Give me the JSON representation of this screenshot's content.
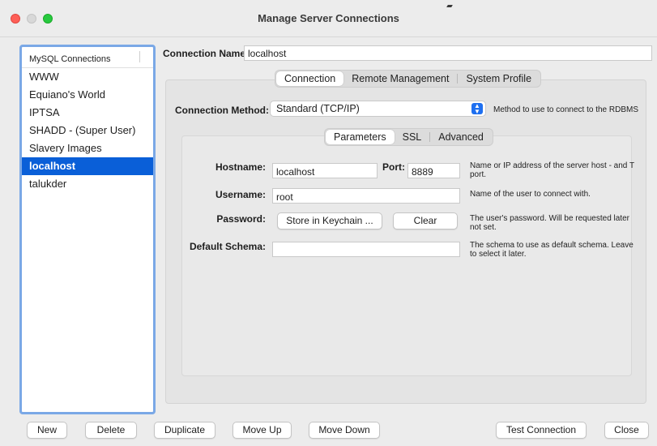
{
  "window": {
    "title": "Manage Server Connections"
  },
  "sidebar": {
    "header": "MySQL Connections",
    "items": [
      {
        "label": "WWW",
        "selected": false
      },
      {
        "label": "Equiano's World",
        "selected": false
      },
      {
        "label": "IPTSA",
        "selected": false
      },
      {
        "label": "SHADD - (Super User)",
        "selected": false
      },
      {
        "label": "Slavery Images",
        "selected": false
      },
      {
        "label": "localhost",
        "selected": true
      },
      {
        "label": "talukder",
        "selected": false
      }
    ]
  },
  "connection_name": {
    "label": "Connection Name:",
    "value": "localhost"
  },
  "main_tabs": [
    {
      "label": "Connection",
      "active": true
    },
    {
      "label": "Remote Management",
      "active": false
    },
    {
      "label": "System Profile",
      "active": false
    }
  ],
  "connection_method": {
    "label": "Connection Method:",
    "value": "Standard (TCP/IP)",
    "help": "Method to use to connect to the RDBMS"
  },
  "sub_tabs": [
    {
      "label": "Parameters",
      "active": true
    },
    {
      "label": "SSL",
      "active": false
    },
    {
      "label": "Advanced",
      "active": false
    }
  ],
  "params": {
    "hostname_label": "Hostname:",
    "hostname_value": "localhost",
    "port_label": "Port:",
    "port_value": "8889",
    "hostname_help_1": "Name or IP address of the server host - and T",
    "hostname_help_2": "port.",
    "username_label": "Username:",
    "username_value": "root",
    "username_help": "Name of the user to connect with.",
    "password_label": "Password:",
    "store_keychain": "Store in Keychain ...",
    "clear": "Clear",
    "password_help_1": "The user's password. Will be requested later",
    "password_help_2": "not set.",
    "schema_label": "Default Schema:",
    "schema_value": "",
    "schema_help_1": "The schema to use as default schema. Leave",
    "schema_help_2": "to select it later."
  },
  "footer": {
    "new": "New",
    "delete": "Delete",
    "duplicate": "Duplicate",
    "move_up": "Move Up",
    "move_down": "Move Down",
    "test_connection": "Test Connection",
    "close": "Close"
  }
}
